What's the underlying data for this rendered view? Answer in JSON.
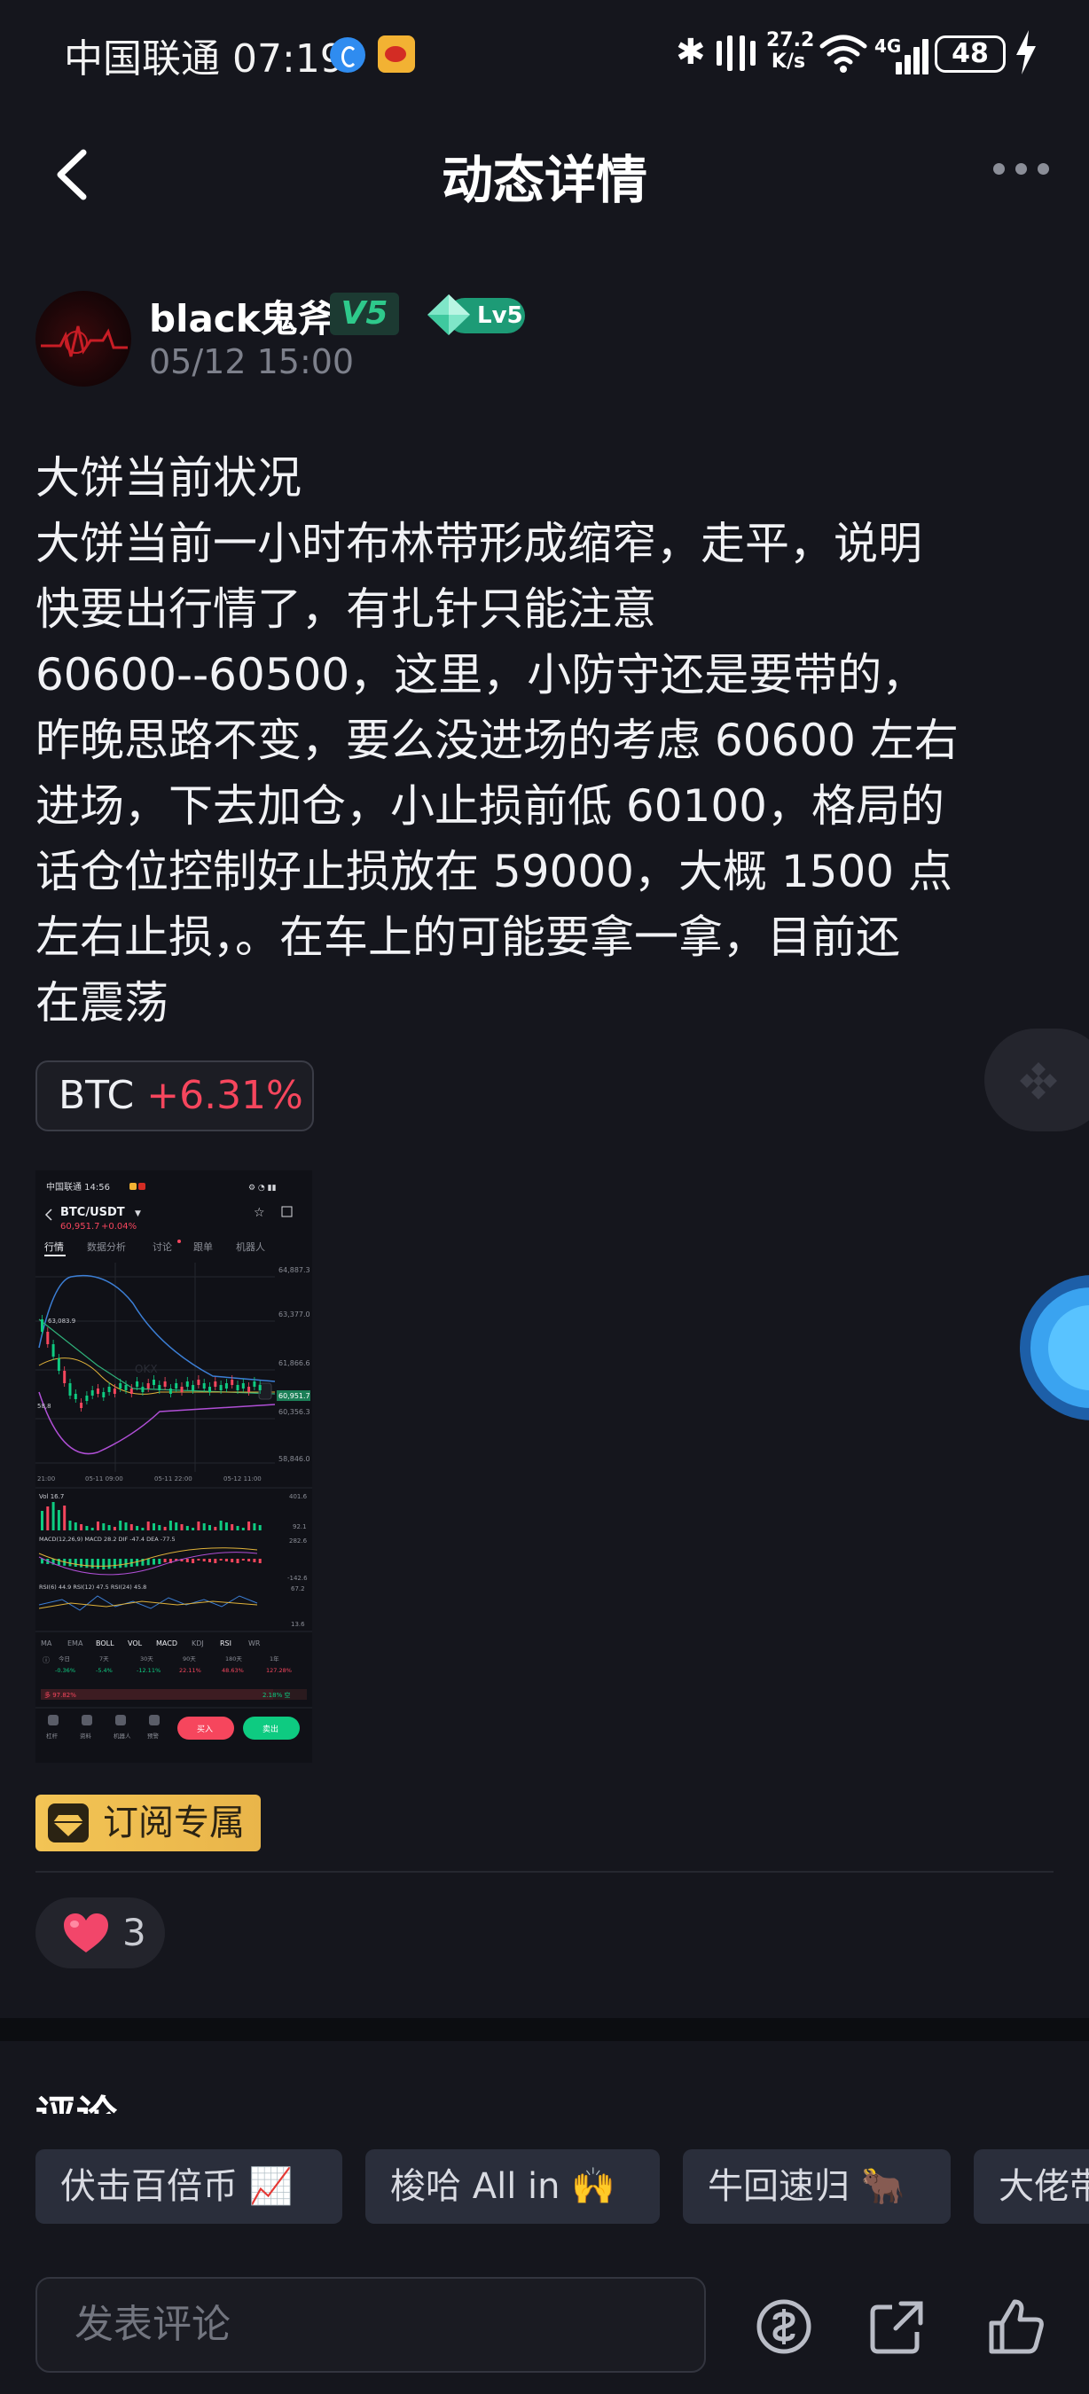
{
  "status_bar": {
    "carrier": "中国联通",
    "time": "07:19",
    "speed_value": "27.2",
    "speed_unit": "K/s",
    "network": "4G",
    "battery": "48"
  },
  "header": {
    "title": "动态详情",
    "back_icon": "chevron-left-icon",
    "more_icon": "more-dots-icon"
  },
  "author": {
    "name": "black鬼斧",
    "vip_badge": "V5",
    "level_badge": "Lv5",
    "time": "05/12 15:00"
  },
  "post": {
    "lines": [
      "大饼当前状况",
      "大饼当前一小时布林带形成缩窄，走平，说明",
      "快要出行情了，有扎针只能注意",
      "60600--60500，这里，小防守还是要带的，",
      "昨晚思路不变，要么没进场的考虑 60600 左右",
      "进场，下去加仓，小止损前低 60100，格局的",
      "话仓位控制好止损放在 59000，大概 1500 点",
      "左右止损，。在车上的可能要拿一拿，目前还",
      "在震荡"
    ]
  },
  "coin_tag": {
    "symbol": "BTC",
    "change": "+6.31%",
    "change_color": "#f6465d"
  },
  "embedded_screenshot": {
    "status": "中国联通 14:56",
    "pair": "BTC/USDT",
    "price": "60,951.7",
    "price_change": "+0.04%",
    "tabs": [
      "行情",
      "数据分析",
      "讨论",
      "跟单",
      "机器人"
    ],
    "price_scale": [
      "64,887.3",
      "63,377.0",
      "61,866.6",
      "60,951.7",
      "60,356.3",
      "58,846.0"
    ],
    "boll_mark": "63,083.9",
    "low_mark": "58,8",
    "time_axis": [
      "21:00",
      "05-11 09:00",
      "05-11 22:00",
      "05-12 11:00"
    ],
    "vol_label": "Vol 16.7",
    "vol_scale": [
      "401.6",
      "92.1"
    ],
    "macd_label": "MACD(12,26,9)  MACD 28.2  DIF -47.4  DEA -77.5",
    "macd_scale": [
      "282.6",
      "-142.6"
    ],
    "rsi_label": "RSI(6) 44.9  RSI(12) 47.5  RSI(24) 45.8",
    "rsi_scale": [
      "67.2",
      "13.6"
    ],
    "indicators": [
      "MA",
      "EMA",
      "BOLL",
      "VOL",
      "MACD",
      "KDJ",
      "RSI",
      "WR"
    ],
    "perf_periods": [
      "今日",
      "7天",
      "30天",
      "90天",
      "180天",
      "1年"
    ],
    "perf_values": [
      "-0.36%",
      "-5.4%",
      "-12.11%",
      "22.11%",
      "48.63%",
      "127.28%"
    ],
    "ratio_left": "多 97.82%",
    "ratio_right": "2.18% 空",
    "bottom_nav": [
      "杠杆",
      "资料",
      "机器人",
      "预警"
    ],
    "buy": "买入",
    "sell": "卖出"
  },
  "subscription": {
    "label": "订阅专属"
  },
  "likes": {
    "count": "3"
  },
  "comments": {
    "heading": "评论",
    "quick_replies": [
      "伏击百倍币 📈",
      "梭哈 All in 🙌",
      "牛回速归 🐂",
      "大佬带"
    ],
    "input_placeholder": "发表评论"
  },
  "colors": {
    "background": "#15161d",
    "up": "#0ecb81",
    "down": "#f6465d",
    "accent": "#1d9b76",
    "gold": "#f3c455"
  }
}
